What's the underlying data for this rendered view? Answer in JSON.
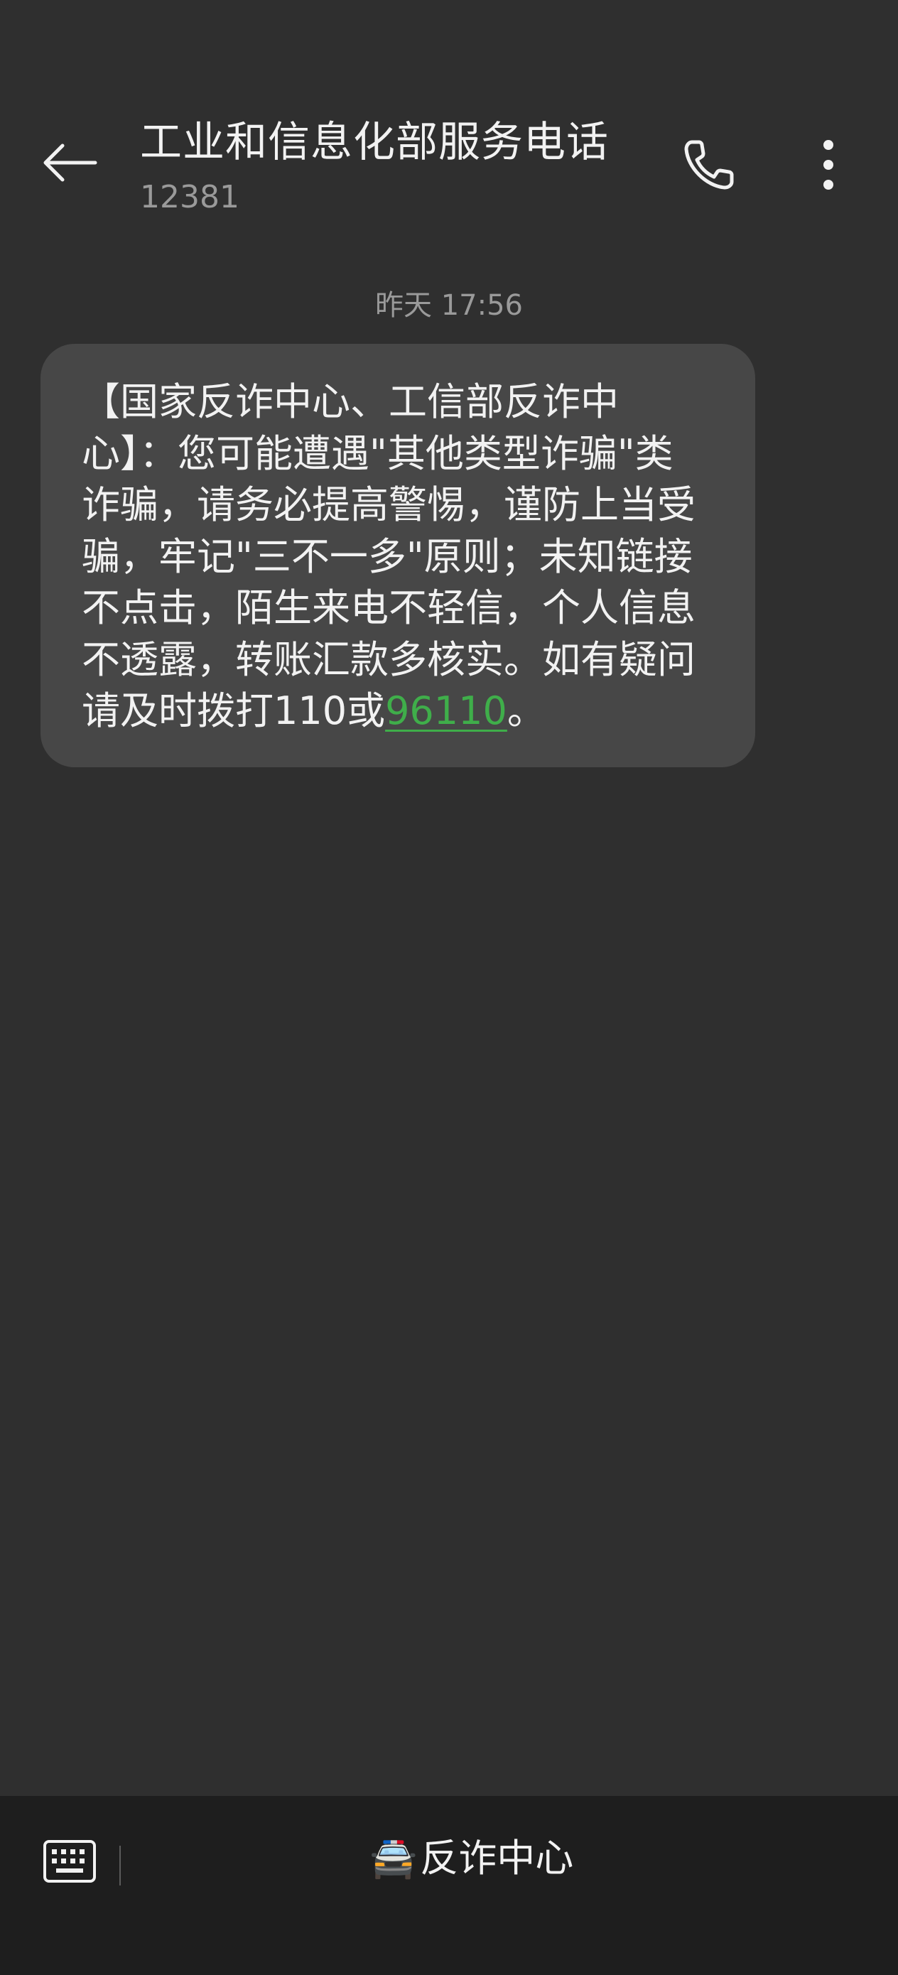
{
  "header": {
    "title": "工业和信息化部服务电话",
    "subtitle": "12381",
    "back_icon": "arrow-left-icon",
    "call_icon": "phone-icon",
    "more_icon": "more-vertical-icon"
  },
  "conversation": {
    "timestamp": "昨天 17:56",
    "message": {
      "lines": [
        "【国家反诈中心、工信部反诈中",
        "心】：您可能遭遇\"其他类型诈骗\"类",
        "诈骗，请务必提高警惕，谨防上当受",
        "骗，牢记\"三不一多\"原则；未知链接",
        "不点击，陌生来电不轻信，个人信息",
        "不透露，转账汇款多核实。如有疑问"
      ],
      "last_line_prefix": "请及时拨打110或",
      "link_number": "96110",
      "last_line_suffix": "。",
      "link_color": "#3fae4a"
    }
  },
  "bottom_bar": {
    "keyboard_icon": "keyboard-icon",
    "menu_emoji": "🚔",
    "menu_label": "反诈中心"
  }
}
